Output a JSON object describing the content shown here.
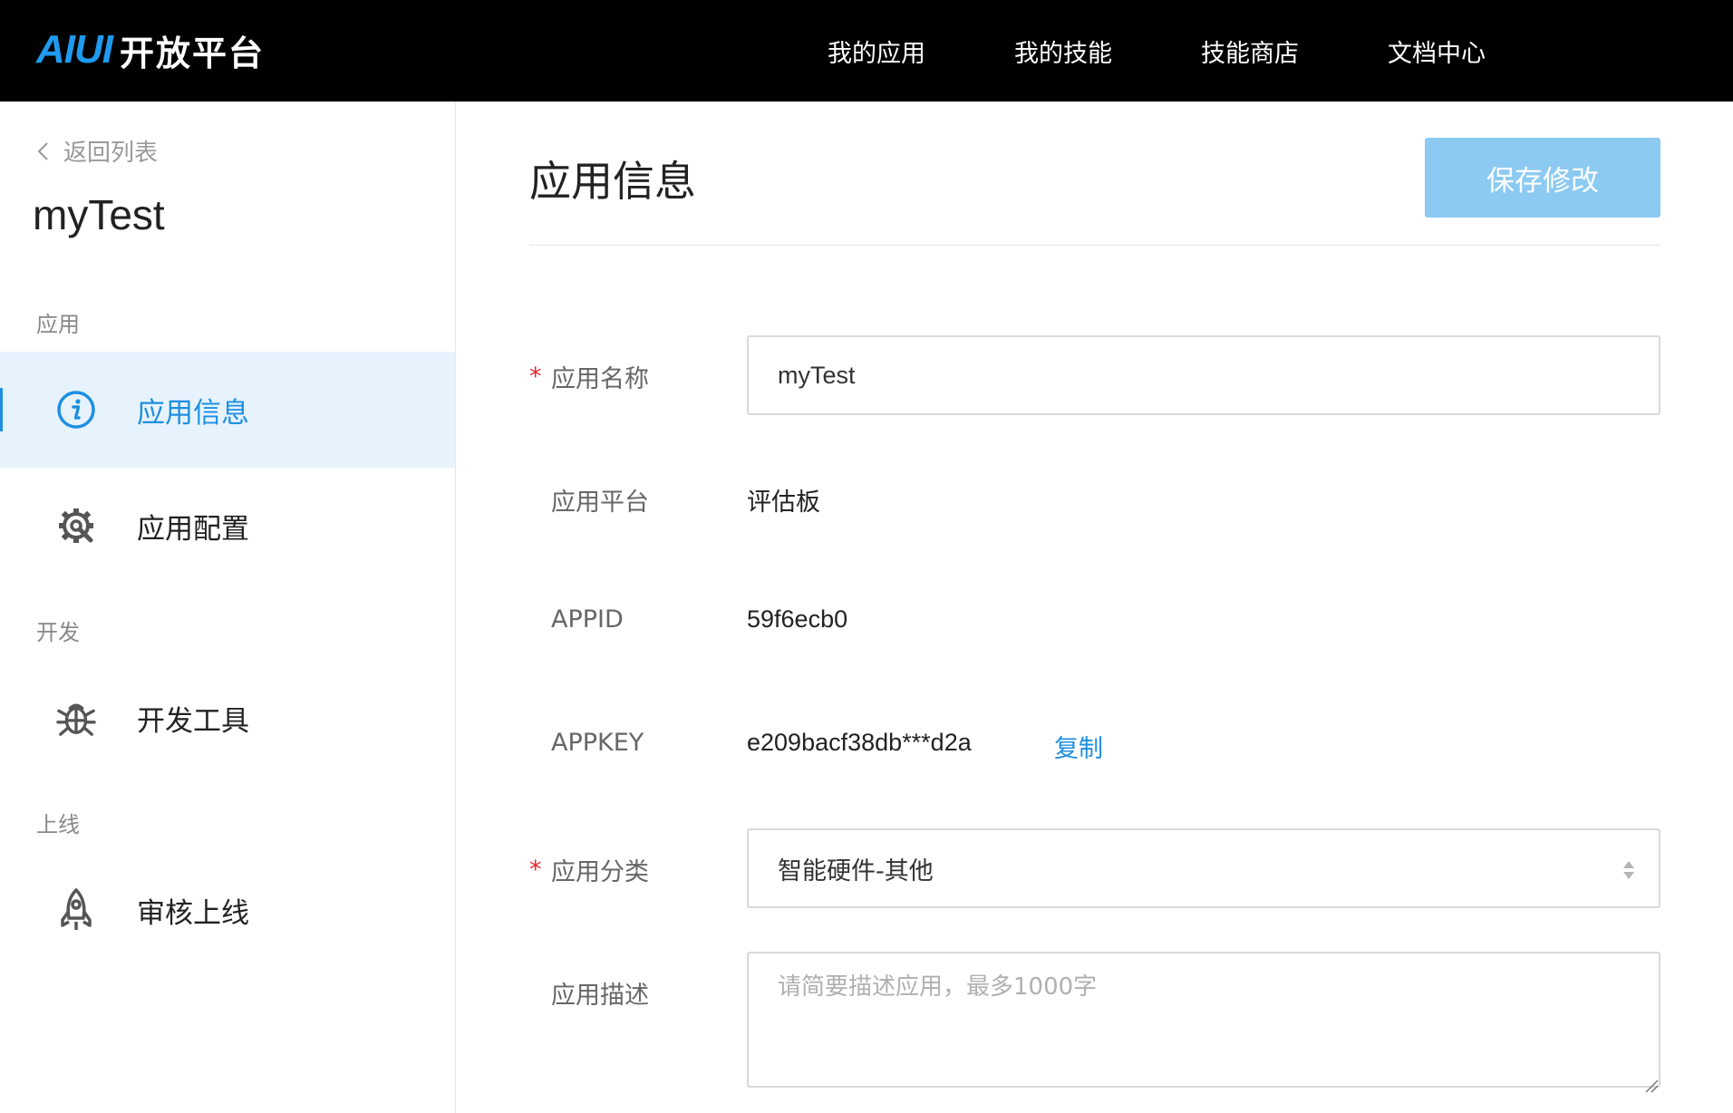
{
  "header": {
    "logo_mark": "AIUI",
    "logo_text": "开放平台",
    "nav": [
      "我的应用",
      "我的技能",
      "技能商店",
      "文档中心"
    ]
  },
  "sidebar": {
    "back_label": "返回列表",
    "app_name": "myTest",
    "sections": [
      {
        "title": "应用",
        "items": [
          {
            "label": "应用信息",
            "icon": "info-icon",
            "active": true
          },
          {
            "label": "应用配置",
            "icon": "gear-icon",
            "active": false
          }
        ]
      },
      {
        "title": "开发",
        "items": [
          {
            "label": "开发工具",
            "icon": "bug-icon",
            "active": false
          }
        ]
      },
      {
        "title": "上线",
        "items": [
          {
            "label": "审核上线",
            "icon": "rocket-icon",
            "active": false
          }
        ]
      }
    ]
  },
  "main": {
    "title": "应用信息",
    "save_label": "保存修改",
    "fields": {
      "name": {
        "label": "应用名称",
        "required": true,
        "value": "myTest"
      },
      "platform": {
        "label": "应用平台",
        "value": "评估板"
      },
      "appid": {
        "label": "APPID",
        "value": "59f6ecb0"
      },
      "appkey": {
        "label": "APPKEY",
        "value": "e209bacf38db***d2a",
        "copy_label": "复制"
      },
      "category": {
        "label": "应用分类",
        "required": true,
        "value": "智能硬件-其他"
      },
      "description": {
        "label": "应用描述",
        "placeholder": "请简要描述应用，最多1000字"
      }
    }
  },
  "colors": {
    "accent": "#1e8fe1",
    "active_bg": "#e6f3fd",
    "button_disabled": "#8ccaf2",
    "required": "#e8262f",
    "topbar": "#000000"
  }
}
